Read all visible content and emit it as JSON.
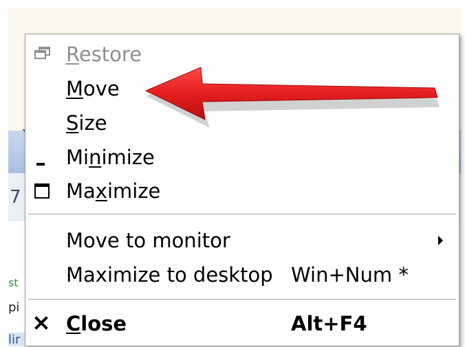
{
  "menu": {
    "items": [
      {
        "id": "restore",
        "before": "",
        "mnemonic": "R",
        "after": "estore",
        "shortcut": "",
        "enabled": false,
        "icon": "restore-icon"
      },
      {
        "id": "move",
        "before": "",
        "mnemonic": "M",
        "after": "ove",
        "shortcut": "",
        "enabled": true,
        "icon": ""
      },
      {
        "id": "size",
        "before": "",
        "mnemonic": "S",
        "after": "ize",
        "shortcut": "",
        "enabled": true,
        "icon": ""
      },
      {
        "id": "minimize",
        "before": "Mi",
        "mnemonic": "n",
        "after": "imize",
        "shortcut": "",
        "enabled": true,
        "icon": "minimize-icon"
      },
      {
        "id": "maximize",
        "before": "Ma",
        "mnemonic": "x",
        "after": "imize",
        "shortcut": "",
        "enabled": true,
        "icon": "maximize-icon"
      },
      {
        "id": "move-to-monitor",
        "text": "Move to monitor",
        "shortcut": "",
        "enabled": true,
        "submenu": true
      },
      {
        "id": "maximize-to-desktop",
        "text": "Maximize to desktop",
        "shortcut": "Win+Num *",
        "enabled": true
      },
      {
        "id": "close",
        "before": "",
        "mnemonic": "C",
        "after": "lose",
        "shortcut": "Alt+F4",
        "enabled": true,
        "icon": "close-icon",
        "bold": true
      }
    ]
  },
  "background": {
    "tab_text": "7",
    "label_a": "st",
    "label_b": "pi",
    "label_c": "lir"
  },
  "colors": {
    "callout_arrow": "#e41e1e",
    "disabled_text": "#8f8f8f",
    "menu_border": "#9a9a9a"
  }
}
